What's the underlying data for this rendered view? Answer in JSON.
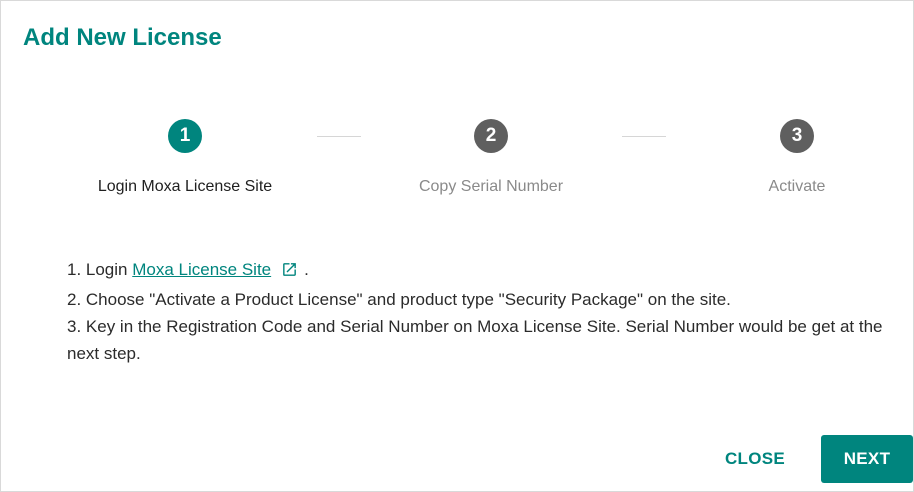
{
  "dialog": {
    "title": "Add New License"
  },
  "stepper": {
    "steps": [
      {
        "number": "1",
        "label": "Login Moxa License Site",
        "state": "active"
      },
      {
        "number": "2",
        "label": "Copy Serial Number",
        "state": "inactive"
      },
      {
        "number": "3",
        "label": "Activate",
        "state": "inactive"
      }
    ]
  },
  "instructions": {
    "line1_prefix": "1. Login ",
    "line1_link": "Moxa License Site",
    "line1_link_icon": "external-link-icon",
    "line1_suffix": ".",
    "line2": "2. Choose \"Activate a Product License\" and product type \"Security Package\" on the site.",
    "line3": "3. Key in the Registration Code and Serial Number on Moxa License Site. Serial Number would be get at the next step."
  },
  "actions": {
    "close_label": "CLOSE",
    "next_label": "NEXT"
  },
  "colors": {
    "accent": "#00857e",
    "inactive_step": "#5f5f5f"
  }
}
